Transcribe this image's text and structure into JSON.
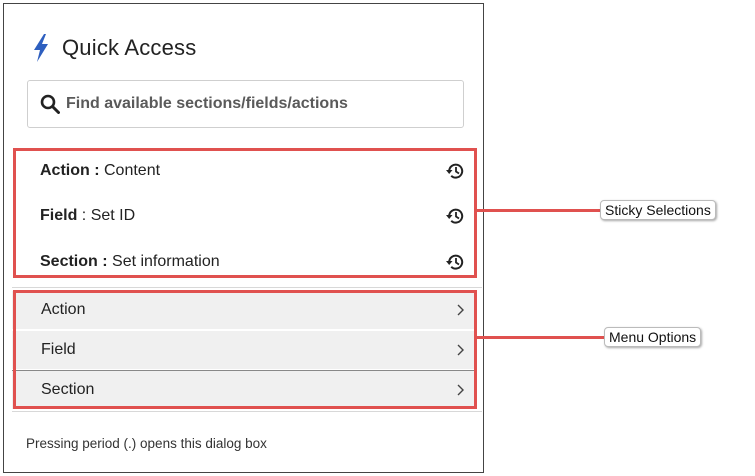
{
  "dialog": {
    "title": "Quick Access",
    "search": {
      "placeholder": "Find available sections/fields/actions",
      "value": ""
    },
    "sticky_selections": [
      {
        "type": "Action",
        "separator": " : ",
        "value": "Content"
      },
      {
        "type": "Field",
        "separator": " : ",
        "value": "Set ID"
      },
      {
        "type": "Section",
        "separator": " : ",
        "value": "Set information"
      }
    ],
    "menu_options": [
      {
        "label": "Action"
      },
      {
        "label": "Field"
      },
      {
        "label": "Section"
      }
    ],
    "footer": "Pressing period (.) opens this dialog box"
  },
  "callouts": {
    "sticky": "Sticky Selections",
    "menu": "Menu Options"
  },
  "icons": {
    "title": "lightning-bolt-icon",
    "search": "magnifier-icon",
    "history": "history-icon",
    "chevron": "chevron-right-icon"
  },
  "colors": {
    "accent_bolt": "#2e5fbf",
    "annotation_red": "#e0514f",
    "menu_bg": "#f0f0f0"
  }
}
